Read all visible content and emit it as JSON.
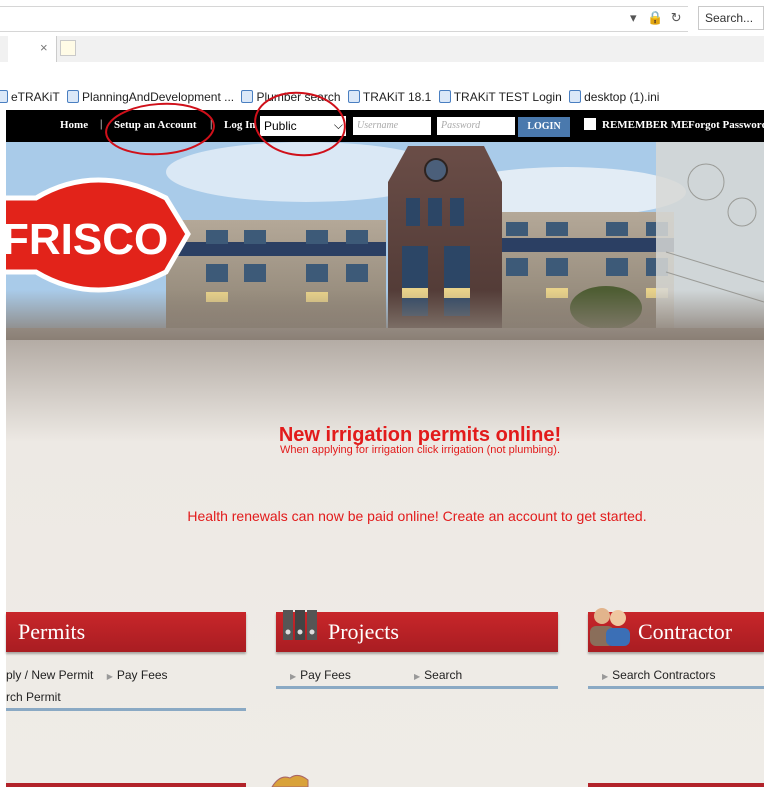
{
  "browser": {
    "search_placeholder": "Search...",
    "tab_close": "×",
    "favorites": [
      "eTRAKiT",
      "PlanningAndDevelopment ...",
      "Plumber search",
      "TRAKiT 18.1",
      "TRAKiT TEST Login",
      "desktop (1).ini"
    ]
  },
  "nav": {
    "home": "Home",
    "sep": "|",
    "setup": "Setup an Account",
    "login_as": "Log In",
    "select_value": "Public",
    "username_placeholder": "Username",
    "password_placeholder": "Password",
    "login_button": "LOGIN",
    "remember": "REMEMBER ME",
    "forgot": "Forgot Password"
  },
  "hero": {
    "logo_text": "FRISCO"
  },
  "notice": {
    "title": "New irrigation permits online!",
    "subtitle": "When applying for irrigation click irrigation (not plumbing).",
    "health": "Health renewals can now be paid online! Create an account to get started."
  },
  "sections": {
    "permits": {
      "title": "Permits",
      "links": [
        "ply / New Permit",
        "Pay Fees",
        "rch Permit"
      ]
    },
    "projects": {
      "title": "Projects",
      "links": [
        "Pay Fees",
        "Search"
      ]
    },
    "contractor": {
      "title": "Contractor",
      "links": [
        "Search Contractors"
      ]
    }
  },
  "colors": {
    "accent_red": "#c8262a",
    "nav_black": "#000000",
    "login_blue": "#4a79ad",
    "annotation_red": "#d0101a"
  }
}
